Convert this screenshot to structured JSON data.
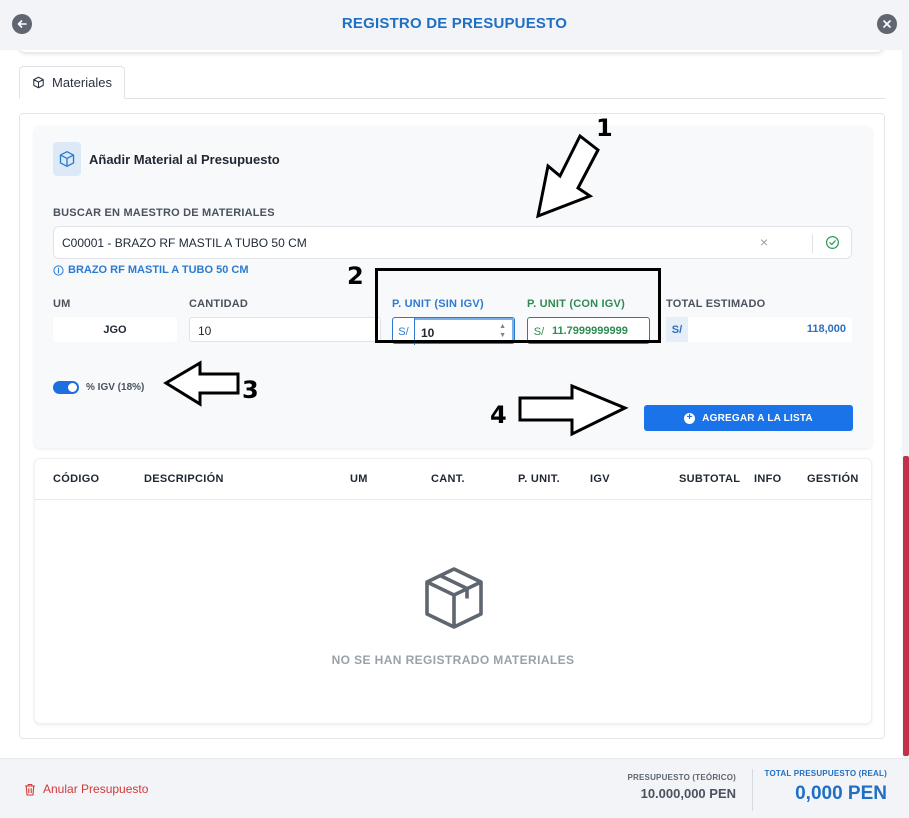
{
  "header": {
    "title": "REGISTRO DE PRESUPUESTO",
    "back_icon": "arrow-left-icon",
    "close_icon": "close-icon"
  },
  "tabs": [
    {
      "label": "Materiales",
      "icon": "cube-icon"
    }
  ],
  "form": {
    "title": "Añadir Material al Presupuesto",
    "search_label": "BUSCAR EN MAESTRO DE MATERIALES",
    "search_value": "C00001 - BRAZO RF MASTIL A TUBO 50 CM",
    "selected_info": "BRAZO RF MASTIL A TUBO 50 CM",
    "um_label": "UM",
    "um_value": "JGO",
    "qty_label": "CANTIDAD",
    "qty_value": "10",
    "unit_no_igv_label": "P. UNIT (SIN IGV)",
    "unit_no_igv_prefix": "S/",
    "unit_no_igv_value": "10",
    "unit_igv_label": "P. UNIT (CON IGV)",
    "unit_igv_prefix": "S/",
    "unit_igv_value": "11.7999999999",
    "total_label": "TOTAL ESTIMADO",
    "total_prefix": "S/",
    "total_value": "118,000",
    "igv_toggle_on": true,
    "igv_label": "% IGV (18%)",
    "add_button": "AGREGAR A LA LISTA"
  },
  "table": {
    "columns": [
      "CÓDIGO",
      "DESCRIPCIÓN",
      "UM",
      "CANT.",
      "P. UNIT.",
      "IGV",
      "SUBTOTAL",
      "INFO",
      "GESTIÓN"
    ],
    "rows": [],
    "empty_text": "NO SE HAN REGISTRADO MATERIALES"
  },
  "footer": {
    "cancel_label": "Anular Presupuesto",
    "theoretical_label": "PRESUPUESTO (TEÓRICO)",
    "theoretical_value": "10.000,000 PEN",
    "real_label": "TOTAL PRESUPUESTO (REAL)",
    "real_value": "0,000 PEN"
  },
  "annotations": [
    "1",
    "2",
    "3",
    "4"
  ],
  "colors": {
    "accent": "#1a73e8",
    "title": "#1f6fc4",
    "green": "#2f8a52",
    "danger": "#d23a3a"
  }
}
